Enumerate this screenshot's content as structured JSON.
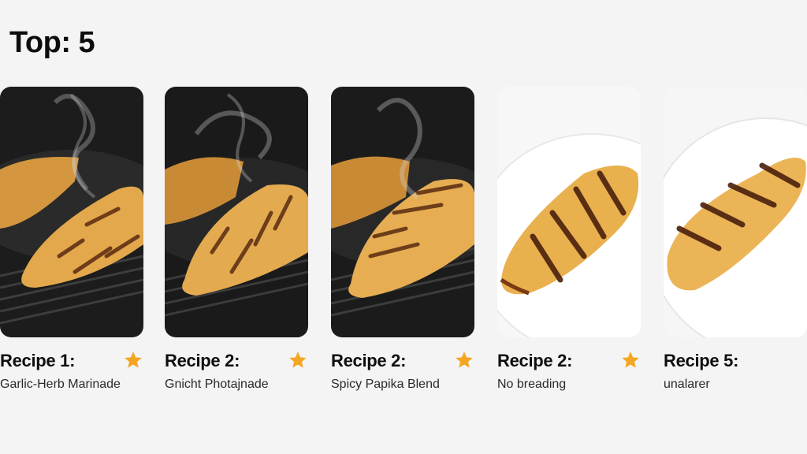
{
  "header": {
    "title": "Top: 5"
  },
  "accent_color": "#f4a623",
  "cards": [
    {
      "title": "Recipe 1:",
      "subtitle": "Garlic-Herb Marinade",
      "starred": true,
      "image": "grilled-chicken-in-air-fryer-with-steam"
    },
    {
      "title": "Recipe 2:",
      "subtitle": "Gnicht Photajnade",
      "starred": true,
      "image": "grilled-chicken-in-air-fryer-with-steam"
    },
    {
      "title": "Recipe 2:",
      "subtitle": "Spicy Papika Blend",
      "starred": true,
      "image": "grilled-chicken-in-air-fryer-with-steam"
    },
    {
      "title": "Recipe 2:",
      "subtitle": "No breading",
      "starred": true,
      "image": "grilled-chicken-on-white-plate"
    },
    {
      "title": "Recipe 5:",
      "subtitle": "unalarer",
      "starred": false,
      "image": "grilled-chicken-on-white-plate"
    }
  ]
}
